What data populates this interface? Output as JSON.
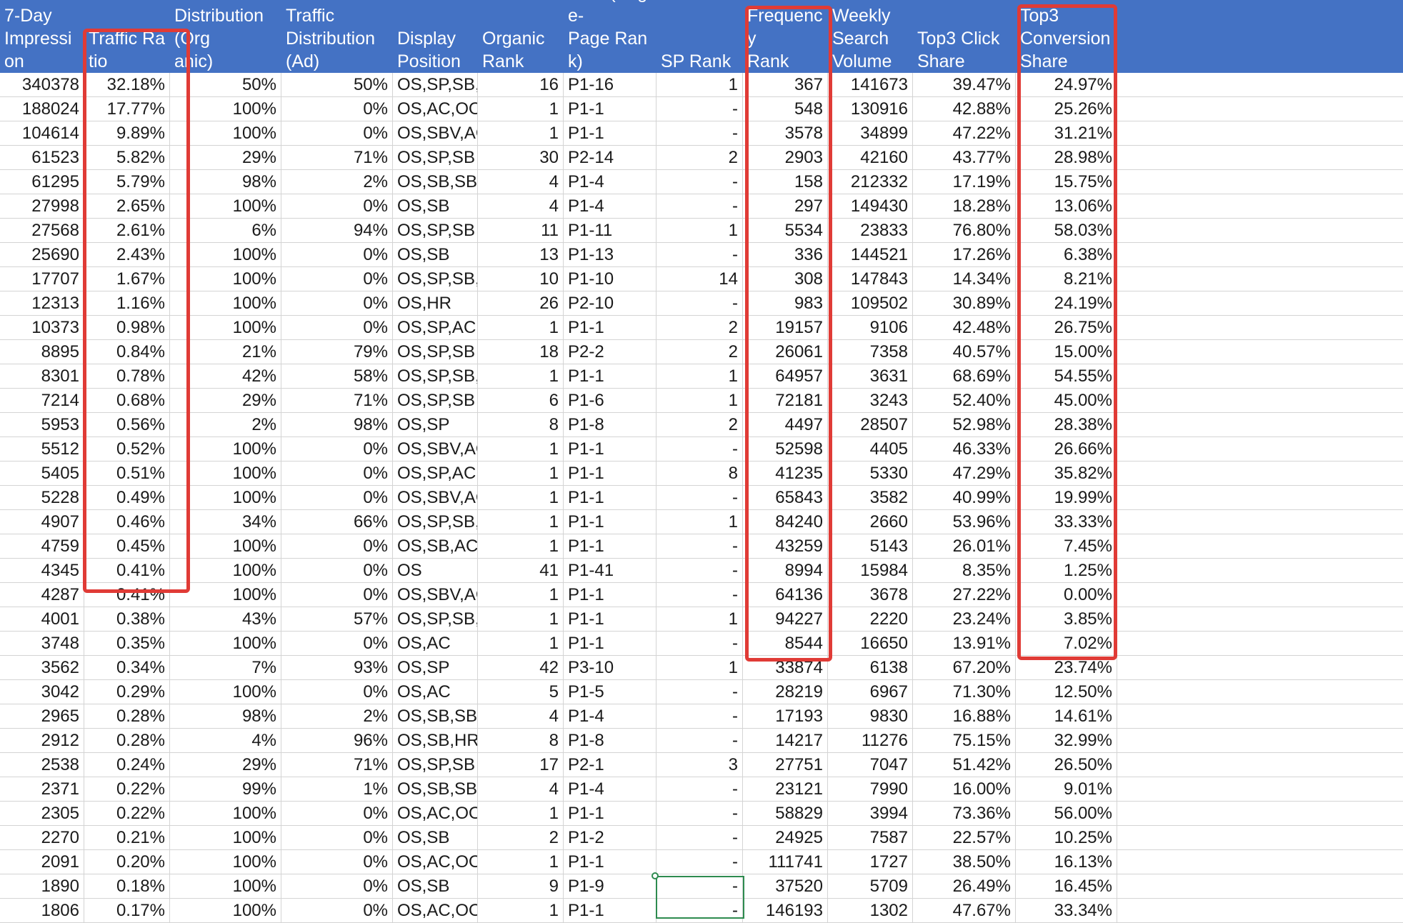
{
  "columns": [
    {
      "key": "impression",
      "label": "7-Day\nImpression",
      "align": "num"
    },
    {
      "key": "ratio",
      "label": "Traffic Ratio",
      "align": "num"
    },
    {
      "key": "dist_org",
      "label": "Traffic\nDistribution(Org\nanic)",
      "align": "num"
    },
    {
      "key": "dist_ad",
      "label": "Traffic\nDistribution(Ad)",
      "align": "num"
    },
    {
      "key": "display",
      "label": "Display\nPosition",
      "align": "txt"
    },
    {
      "key": "org_rank",
      "label": "Organic\nRank",
      "align": "num"
    },
    {
      "key": "org_page_rank",
      "label": "Organic\nRank(Page-\nPage Rank)",
      "align": "txt"
    },
    {
      "key": "sp_rank",
      "label": "SP Rank",
      "align": "num"
    },
    {
      "key": "sfr",
      "label": "Search\nFrequency\nRank",
      "align": "num"
    },
    {
      "key": "wsv",
      "label": "Weekly\nSearch\nVolume",
      "align": "num"
    },
    {
      "key": "click_share",
      "label": "Top3 Click\nShare",
      "align": "num"
    },
    {
      "key": "conv_share",
      "label": "Top3\nConversion\nShare",
      "align": "num"
    }
  ],
  "rows": [
    [
      "340378",
      "32.18%",
      "50%",
      "50%",
      "OS,SP,SB,OOR",
      "16",
      "P1-16",
      "1",
      "367",
      "141673",
      "39.47%",
      "24.97%"
    ],
    [
      "188024",
      "17.77%",
      "100%",
      "0%",
      "OS,AC,OOR,HR",
      "1",
      "P1-1",
      "-",
      "548",
      "130916",
      "42.88%",
      "25.26%"
    ],
    [
      "104614",
      "9.89%",
      "100%",
      "0%",
      "OS,SBV,AC,OOR",
      "1",
      "P1-1",
      "-",
      "3578",
      "34899",
      "47.22%",
      "31.21%"
    ],
    [
      "61523",
      "5.82%",
      "29%",
      "71%",
      "OS,SP,SB",
      "30",
      "P2-14",
      "2",
      "2903",
      "42160",
      "43.77%",
      "28.98%"
    ],
    [
      "61295",
      "5.79%",
      "98%",
      "2%",
      "OS,SB,SBV,AC",
      "4",
      "P1-4",
      "-",
      "158",
      "212332",
      "17.19%",
      "15.75%"
    ],
    [
      "27998",
      "2.65%",
      "100%",
      "0%",
      "OS,SB",
      "4",
      "P1-4",
      "-",
      "297",
      "149430",
      "18.28%",
      "13.06%"
    ],
    [
      "27568",
      "2.61%",
      "6%",
      "94%",
      "OS,SP,SB",
      "11",
      "P1-11",
      "1",
      "5534",
      "23833",
      "76.80%",
      "58.03%"
    ],
    [
      "25690",
      "2.43%",
      "100%",
      "0%",
      "OS,SB",
      "13",
      "P1-13",
      "-",
      "336",
      "144521",
      "17.26%",
      "6.38%"
    ],
    [
      "17707",
      "1.67%",
      "100%",
      "0%",
      "OS,SP,SB,HR",
      "10",
      "P1-10",
      "14",
      "308",
      "147843",
      "14.34%",
      "8.21%"
    ],
    [
      "12313",
      "1.16%",
      "100%",
      "0%",
      "OS,HR",
      "26",
      "P2-10",
      "-",
      "983",
      "109502",
      "30.89%",
      "24.19%"
    ],
    [
      "10373",
      "0.98%",
      "100%",
      "0%",
      "OS,SP,AC,OOR",
      "1",
      "P1-1",
      "2",
      "19157",
      "9106",
      "42.48%",
      "26.75%"
    ],
    [
      "8895",
      "0.84%",
      "21%",
      "79%",
      "OS,SP,SB",
      "18",
      "P2-2",
      "2",
      "26061",
      "7358",
      "40.57%",
      "15.00%"
    ],
    [
      "8301",
      "0.78%",
      "42%",
      "58%",
      "OS,SP,SB,AC,OOR",
      "1",
      "P1-1",
      "1",
      "64957",
      "3631",
      "68.69%",
      "54.55%"
    ],
    [
      "7214",
      "0.68%",
      "29%",
      "71%",
      "OS,SP,SB",
      "6",
      "P1-6",
      "1",
      "72181",
      "3243",
      "52.40%",
      "45.00%"
    ],
    [
      "5953",
      "0.56%",
      "2%",
      "98%",
      "OS,SP",
      "8",
      "P1-8",
      "2",
      "4497",
      "28507",
      "52.98%",
      "28.38%"
    ],
    [
      "5512",
      "0.52%",
      "100%",
      "0%",
      "OS,SBV,AC,OOR",
      "1",
      "P1-1",
      "-",
      "52598",
      "4405",
      "46.33%",
      "26.66%"
    ],
    [
      "5405",
      "0.51%",
      "100%",
      "0%",
      "OS,SP,AC,OOR",
      "1",
      "P1-1",
      "8",
      "41235",
      "5330",
      "47.29%",
      "35.82%"
    ],
    [
      "5228",
      "0.49%",
      "100%",
      "0%",
      "OS,SBV,AC,OOR",
      "1",
      "P1-1",
      "-",
      "65843",
      "3582",
      "40.99%",
      "19.99%"
    ],
    [
      "4907",
      "0.46%",
      "34%",
      "66%",
      "OS,SP,SB,AC,HR",
      "1",
      "P1-1",
      "1",
      "84240",
      "2660",
      "53.96%",
      "33.33%"
    ],
    [
      "4759",
      "0.45%",
      "100%",
      "0%",
      "OS,SB,AC",
      "1",
      "P1-1",
      "-",
      "43259",
      "5143",
      "26.01%",
      "7.45%"
    ],
    [
      "4345",
      "0.41%",
      "100%",
      "0%",
      "OS",
      "41",
      "P1-41",
      "-",
      "8994",
      "15984",
      "8.35%",
      "1.25%"
    ],
    [
      "4287",
      "0.41%",
      "100%",
      "0%",
      "OS,SBV,AC,HR",
      "1",
      "P1-1",
      "-",
      "64136",
      "3678",
      "27.22%",
      "0.00%"
    ],
    [
      "4001",
      "0.38%",
      "43%",
      "57%",
      "OS,SP,SB,AC",
      "1",
      "P1-1",
      "1",
      "94227",
      "2220",
      "23.24%",
      "3.85%"
    ],
    [
      "3748",
      "0.35%",
      "100%",
      "0%",
      "OS,AC",
      "1",
      "P1-1",
      "-",
      "8544",
      "16650",
      "13.91%",
      "7.02%"
    ],
    [
      "3562",
      "0.34%",
      "7%",
      "93%",
      "OS,SP",
      "42",
      "P3-10",
      "1",
      "33874",
      "6138",
      "67.20%",
      "23.74%"
    ],
    [
      "3042",
      "0.29%",
      "100%",
      "0%",
      "OS,AC",
      "5",
      "P1-5",
      "-",
      "28219",
      "6967",
      "71.30%",
      "12.50%"
    ],
    [
      "2965",
      "0.28%",
      "98%",
      "2%",
      "OS,SB,SBV,HR",
      "4",
      "P1-4",
      "-",
      "17193",
      "9830",
      "16.88%",
      "14.61%"
    ],
    [
      "2912",
      "0.28%",
      "4%",
      "96%",
      "OS,SB,HR",
      "8",
      "P1-8",
      "-",
      "14217",
      "11276",
      "75.15%",
      "32.99%"
    ],
    [
      "2538",
      "0.24%",
      "29%",
      "71%",
      "OS,SP,SB",
      "17",
      "P2-1",
      "3",
      "27751",
      "7047",
      "51.42%",
      "26.50%"
    ],
    [
      "2371",
      "0.22%",
      "99%",
      "1%",
      "OS,SB,SBV",
      "4",
      "P1-4",
      "-",
      "23121",
      "7990",
      "16.00%",
      "9.01%"
    ],
    [
      "2305",
      "0.22%",
      "100%",
      "0%",
      "OS,AC,OOR,HR",
      "1",
      "P1-1",
      "-",
      "58829",
      "3994",
      "73.36%",
      "56.00%"
    ],
    [
      "2270",
      "0.21%",
      "100%",
      "0%",
      "OS,SB",
      "2",
      "P1-2",
      "-",
      "24925",
      "7587",
      "22.57%",
      "10.25%"
    ],
    [
      "2091",
      "0.20%",
      "100%",
      "0%",
      "OS,AC,OOR",
      "1",
      "P1-1",
      "-",
      "111741",
      "1727",
      "38.50%",
      "16.13%"
    ],
    [
      "1890",
      "0.18%",
      "100%",
      "0%",
      "OS,SB",
      "9",
      "P1-9",
      "-",
      "37520",
      "5709",
      "26.49%",
      "16.45%"
    ],
    [
      "1806",
      "0.17%",
      "100%",
      "0%",
      "OS,AC,OOR",
      "1",
      "P1-1",
      "-",
      "146193",
      "1302",
      "47.67%",
      "33.34%"
    ]
  ],
  "highlights": [
    {
      "name": "traffic-ratio-highlight",
      "column": "Traffic Ratio",
      "color": "#e03b36"
    },
    {
      "name": "search-frequency-rank-highlight",
      "column": "Search Frequency Rank",
      "color": "#e03b36"
    },
    {
      "name": "top3-conversion-share-highlight",
      "column": "Top3 Conversion Share",
      "color": "#e03b36"
    }
  ],
  "colors": {
    "header_bg": "#4472c4",
    "header_text": "#ffffff",
    "grid": "#d4d4d4",
    "highlight": "#e03b36",
    "selection": "#2e8b4f"
  }
}
